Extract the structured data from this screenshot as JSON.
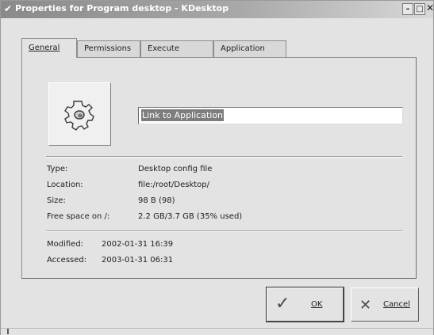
{
  "window": {
    "title": "Properties for Program desktop - KDesktop",
    "menu_glyph": "✔",
    "min_glyph": "–",
    "max_glyph": "□",
    "close_glyph": "✕"
  },
  "tabs": [
    {
      "label": "General",
      "active": true
    },
    {
      "label": "Permissions",
      "active": false
    },
    {
      "label": "Execute",
      "active": false
    },
    {
      "label": "Application",
      "active": false
    }
  ],
  "general": {
    "icon": "gear-icon",
    "name_value": "Link to Application",
    "type_label": "Type:",
    "type_value": "Desktop config file",
    "location_label": "Location:",
    "location_value": "file:/root/Desktop/",
    "size_label": "Size:",
    "size_value": "98 B (98)",
    "free_label": "Free space on /:",
    "free_value": "2.2 GB/3.7 GB (35% used)",
    "modified_label": "Modified:",
    "modified_value": "2002-01-31 16:39",
    "accessed_label": "Accessed:",
    "accessed_value": "2003-01-31 06:31"
  },
  "buttons": {
    "ok_label": "OK",
    "ok_glyph": "✓",
    "cancel_label": "Cancel",
    "cancel_glyph": "✕"
  }
}
